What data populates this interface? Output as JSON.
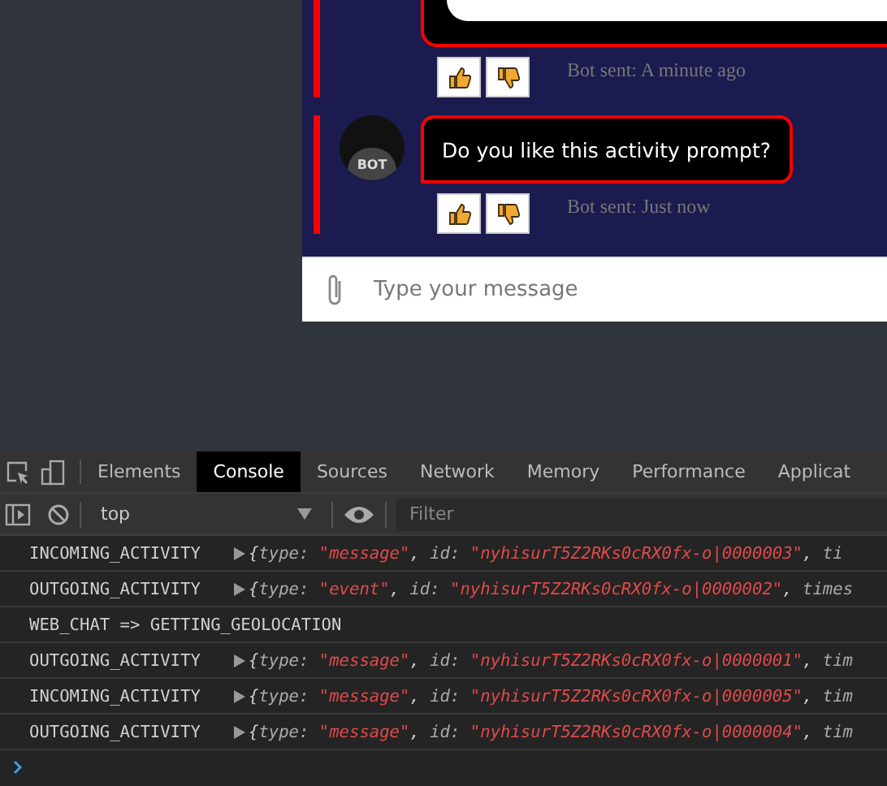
{
  "chat": {
    "messages": [
      {
        "kind": "card",
        "status": "Bot sent: A minute ago"
      },
      {
        "kind": "text",
        "avatar": "BOT",
        "text": "Do you like this activity prompt?",
        "status": "Bot sent: Just now"
      }
    ],
    "input": {
      "placeholder": "Type your message"
    }
  },
  "devtools": {
    "tabs": [
      {
        "label": "Elements",
        "selected": false
      },
      {
        "label": "Console",
        "selected": true
      },
      {
        "label": "Sources",
        "selected": false
      },
      {
        "label": "Network",
        "selected": false
      },
      {
        "label": "Memory",
        "selected": false
      },
      {
        "label": "Performance",
        "selected": false
      },
      {
        "label": "Applicat",
        "selected": false
      }
    ],
    "context": "top",
    "filter": {
      "placeholder": "Filter"
    },
    "console": [
      {
        "label": "INCOMING_ACTIVITY",
        "expandable": true,
        "parts": [
          {
            "kind": "punct",
            "text": "{"
          },
          {
            "kind": "key",
            "text": "type: "
          },
          {
            "kind": "string",
            "text": "\"message\""
          },
          {
            "kind": "punct",
            "text": ", "
          },
          {
            "kind": "key",
            "text": "id: "
          },
          {
            "kind": "string",
            "text": "\"nyhisurT5Z2RKs0cRX0fx-o|0000003\""
          },
          {
            "kind": "punct",
            "text": ", "
          },
          {
            "kind": "key",
            "text": "ti"
          }
        ]
      },
      {
        "label": "OUTGOING_ACTIVITY",
        "expandable": true,
        "parts": [
          {
            "kind": "punct",
            "text": "{"
          },
          {
            "kind": "key",
            "text": "type: "
          },
          {
            "kind": "string",
            "text": "\"event\""
          },
          {
            "kind": "punct",
            "text": ", "
          },
          {
            "kind": "key",
            "text": "id: "
          },
          {
            "kind": "string",
            "text": "\"nyhisurT5Z2RKs0cRX0fx-o|0000002\""
          },
          {
            "kind": "punct",
            "text": ", "
          },
          {
            "kind": "key",
            "text": "times"
          }
        ]
      },
      {
        "label": "WEB_CHAT => GETTING_GEOLOCATION",
        "expandable": false
      },
      {
        "label": "OUTGOING_ACTIVITY",
        "expandable": true,
        "parts": [
          {
            "kind": "punct",
            "text": "{"
          },
          {
            "kind": "key",
            "text": "type: "
          },
          {
            "kind": "string",
            "text": "\"message\""
          },
          {
            "kind": "punct",
            "text": ", "
          },
          {
            "kind": "key",
            "text": "id: "
          },
          {
            "kind": "string",
            "text": "\"nyhisurT5Z2RKs0cRX0fx-o|0000001\""
          },
          {
            "kind": "punct",
            "text": ", "
          },
          {
            "kind": "key",
            "text": "tim"
          }
        ]
      },
      {
        "label": "INCOMING_ACTIVITY",
        "expandable": true,
        "parts": [
          {
            "kind": "punct",
            "text": "{"
          },
          {
            "kind": "key",
            "text": "type: "
          },
          {
            "kind": "string",
            "text": "\"message\""
          },
          {
            "kind": "punct",
            "text": ", "
          },
          {
            "kind": "key",
            "text": "id: "
          },
          {
            "kind": "string",
            "text": "\"nyhisurT5Z2RKs0cRX0fx-o|0000005\""
          },
          {
            "kind": "punct",
            "text": ", "
          },
          {
            "kind": "key",
            "text": "tim"
          }
        ]
      },
      {
        "label": "OUTGOING_ACTIVITY",
        "expandable": true,
        "parts": [
          {
            "kind": "punct",
            "text": "{"
          },
          {
            "kind": "key",
            "text": "type: "
          },
          {
            "kind": "string",
            "text": "\"message\""
          },
          {
            "kind": "punct",
            "text": ", "
          },
          {
            "kind": "key",
            "text": "id: "
          },
          {
            "kind": "string",
            "text": "\"nyhisurT5Z2RKs0cRX0fx-o|0000004\""
          },
          {
            "kind": "punct",
            "text": ", "
          },
          {
            "kind": "key",
            "text": "tim"
          }
        ]
      }
    ]
  }
}
